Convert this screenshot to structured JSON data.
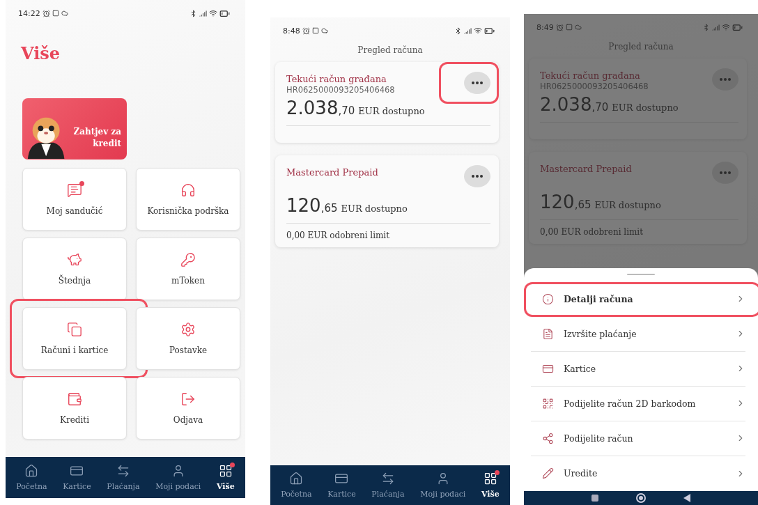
{
  "screens": [
    {
      "kind": "more_menu",
      "status_bar": {
        "time": "14:22"
      },
      "title": "Više",
      "promo": {
        "label": "Zahtjev za kredit"
      },
      "tiles": [
        {
          "label": "Moj sandučić",
          "notification": true,
          "highlighted": false
        },
        {
          "label": "Korisnička podrška",
          "notification": false,
          "highlighted": false
        },
        {
          "label": "Štednja",
          "notification": false,
          "highlighted": false
        },
        {
          "label": "mToken",
          "notification": false,
          "highlighted": false
        },
        {
          "label": "Računi i kartice",
          "notification": false,
          "highlighted": true
        },
        {
          "label": "Postavke",
          "notification": false,
          "highlighted": false
        },
        {
          "label": "Krediti",
          "notification": false,
          "highlighted": false
        },
        {
          "label": "Odjava",
          "notification": false,
          "highlighted": false
        }
      ],
      "nav": [
        {
          "label": "Početna",
          "selected": false,
          "notification": false
        },
        {
          "label": "Kartice",
          "selected": false,
          "notification": false
        },
        {
          "label": "Plaćanja",
          "selected": false,
          "notification": false
        },
        {
          "label": "Moji podaci",
          "selected": false,
          "notification": false
        },
        {
          "label": "Više",
          "selected": true,
          "notification": true
        }
      ]
    },
    {
      "kind": "accounts",
      "status_bar": {
        "time": "8:48"
      },
      "header": "Pregled računa",
      "accounts": [
        {
          "name": "Tekući račun građana",
          "iban": "HR0625000093205406468",
          "amount": "2.038",
          "decimals": ",70",
          "suffix": "EUR dostupno",
          "menu_highlighted": true
        },
        {
          "name": "Mastercard Prepaid",
          "amount": "120",
          "decimals": ",65",
          "suffix": "EUR dostupno",
          "limit": "0,00 EUR odobreni limit",
          "menu_highlighted": false
        }
      ],
      "nav": [
        {
          "label": "Početna",
          "selected": false,
          "notification": false
        },
        {
          "label": "Kartice",
          "selected": false,
          "notification": false
        },
        {
          "label": "Plaćanja",
          "selected": false,
          "notification": false
        },
        {
          "label": "Moji podaci",
          "selected": false,
          "notification": false
        },
        {
          "label": "Više",
          "selected": true,
          "notification": true
        }
      ]
    },
    {
      "kind": "accounts_sheet",
      "status_bar": {
        "time": "8:49"
      },
      "header": "Pregled računa",
      "accounts": [
        {
          "name": "Tekući račun građana",
          "iban": "HR0625000093205406468",
          "amount": "2.038",
          "decimals": ",70",
          "suffix": "EUR dostupno",
          "menu_highlighted": false
        },
        {
          "name": "Mastercard Prepaid",
          "amount": "120",
          "decimals": ",65",
          "suffix": "EUR dostupno",
          "limit": "0,00 EUR odobreni limit",
          "menu_highlighted": false
        }
      ],
      "sheet": [
        {
          "label": "Detalji računa",
          "highlighted": true
        },
        {
          "label": "Izvršite plaćanje",
          "highlighted": false
        },
        {
          "label": "Kartice",
          "highlighted": false
        },
        {
          "label": "Podijelite račun 2D barkodom",
          "highlighted": false
        },
        {
          "label": "Podijelite račun",
          "highlighted": false
        },
        {
          "label": "Uredite",
          "highlighted": false
        }
      ]
    }
  ]
}
